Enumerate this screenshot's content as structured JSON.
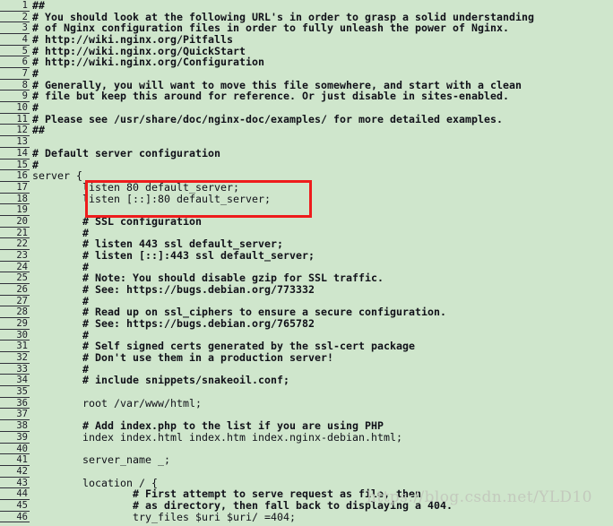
{
  "editor": {
    "background_color": "#cfe6cc",
    "text_color": "#101018",
    "gutter_rule_color": "#30303a",
    "lines": [
      {
        "n": "1",
        "text": "##",
        "style": "comment"
      },
      {
        "n": "2",
        "text": "# You should look at the following URL's in order to grasp a solid understanding",
        "style": "comment"
      },
      {
        "n": "3",
        "text": "# of Nginx configuration files in order to fully unleash the power of Nginx.",
        "style": "comment"
      },
      {
        "n": "4",
        "text": "# http://wiki.nginx.org/Pitfalls",
        "style": "comment"
      },
      {
        "n": "5",
        "text": "# http://wiki.nginx.org/QuickStart",
        "style": "comment"
      },
      {
        "n": "6",
        "text": "# http://wiki.nginx.org/Configuration",
        "style": "comment"
      },
      {
        "n": "7",
        "text": "#",
        "style": "comment"
      },
      {
        "n": "8",
        "text": "# Generally, you will want to move this file somewhere, and start with a clean",
        "style": "comment"
      },
      {
        "n": "9",
        "text": "# file but keep this around for reference. Or just disable in sites-enabled.",
        "style": "comment"
      },
      {
        "n": "10",
        "text": "#",
        "style": "comment"
      },
      {
        "n": "11",
        "text": "# Please see /usr/share/doc/nginx-doc/examples/ for more detailed examples.",
        "style": "comment"
      },
      {
        "n": "12",
        "text": "##",
        "style": "comment"
      },
      {
        "n": "13",
        "text": "",
        "style": "plain"
      },
      {
        "n": "14",
        "text": "# Default server configuration",
        "style": "comment"
      },
      {
        "n": "15",
        "text": "#",
        "style": "comment"
      },
      {
        "n": "16",
        "text": "server {",
        "style": "plain"
      },
      {
        "n": "17",
        "text": "        listen 80 default_server;",
        "style": "plain"
      },
      {
        "n": "18",
        "text": "        listen [::]:80 default_server;",
        "style": "plain"
      },
      {
        "n": "19",
        "text": "",
        "style": "plain"
      },
      {
        "n": "20",
        "text": "        # SSL configuration",
        "style": "comment"
      },
      {
        "n": "21",
        "text": "        #",
        "style": "comment"
      },
      {
        "n": "22",
        "text": "        # listen 443 ssl default_server;",
        "style": "comment"
      },
      {
        "n": "23",
        "text": "        # listen [::]:443 ssl default_server;",
        "style": "comment"
      },
      {
        "n": "24",
        "text": "        #",
        "style": "comment"
      },
      {
        "n": "25",
        "text": "        # Note: You should disable gzip for SSL traffic.",
        "style": "comment"
      },
      {
        "n": "26",
        "text": "        # See: https://bugs.debian.org/773332",
        "style": "comment"
      },
      {
        "n": "27",
        "text": "        #",
        "style": "comment"
      },
      {
        "n": "28",
        "text": "        # Read up on ssl_ciphers to ensure a secure configuration.",
        "style": "comment"
      },
      {
        "n": "29",
        "text": "        # See: https://bugs.debian.org/765782",
        "style": "comment"
      },
      {
        "n": "30",
        "text": "        #",
        "style": "comment"
      },
      {
        "n": "31",
        "text": "        # Self signed certs generated by the ssl-cert package",
        "style": "comment"
      },
      {
        "n": "32",
        "text": "        # Don't use them in a production server!",
        "style": "comment"
      },
      {
        "n": "33",
        "text": "        #",
        "style": "comment"
      },
      {
        "n": "34",
        "text": "        # include snippets/snakeoil.conf;",
        "style": "comment"
      },
      {
        "n": "35",
        "text": "",
        "style": "plain"
      },
      {
        "n": "36",
        "text": "        root /var/www/html;",
        "style": "plain"
      },
      {
        "n": "37",
        "text": "",
        "style": "plain"
      },
      {
        "n": "38",
        "text": "        # Add index.php to the list if you are using PHP",
        "style": "comment"
      },
      {
        "n": "39",
        "text": "        index index.html index.htm index.nginx-debian.html;",
        "style": "plain"
      },
      {
        "n": "40",
        "text": "",
        "style": "plain"
      },
      {
        "n": "41",
        "text": "        server_name _;",
        "style": "plain"
      },
      {
        "n": "42",
        "text": "",
        "style": "plain"
      },
      {
        "n": "43",
        "text": "        location / {",
        "style": "plain"
      },
      {
        "n": "44",
        "text": "                # First attempt to serve request as file, then",
        "style": "comment"
      },
      {
        "n": "45",
        "text": "                # as directory, then fall back to displaying a 404.",
        "style": "comment"
      },
      {
        "n": "46",
        "text": "                try_files $uri $uri/ =404;",
        "style": "plain"
      }
    ]
  },
  "annotation": {
    "type": "rectangle-highlight",
    "color": "#ee1c1c",
    "covers_lines": "17-18"
  },
  "watermark": {
    "text": "https://blog.csdn.net/YLD10",
    "color": "#c3c9bd"
  }
}
